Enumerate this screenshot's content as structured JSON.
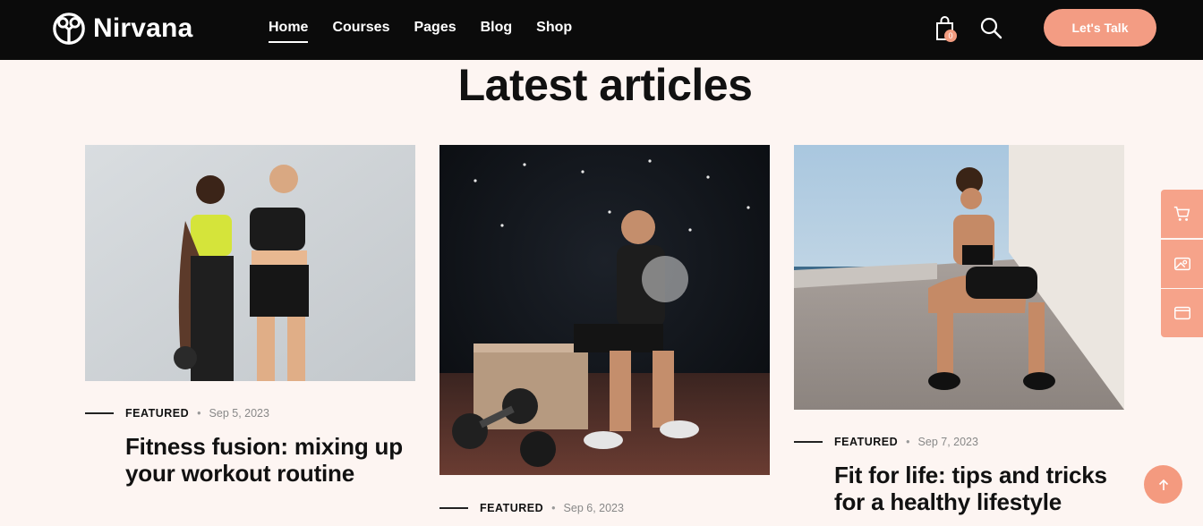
{
  "brand": {
    "name": "Nirvana"
  },
  "nav": [
    {
      "label": "Home",
      "active": true
    },
    {
      "label": "Courses"
    },
    {
      "label": "Pages"
    },
    {
      "label": "Blog"
    },
    {
      "label": "Shop"
    }
  ],
  "header": {
    "cart_count": "0",
    "cta_label": "Let's Talk"
  },
  "section": {
    "title": "Latest articles"
  },
  "articles": [
    {
      "tag": "FEATURED",
      "date": "Sep 5, 2023",
      "title_line1": "Fitness fusion: mixing up",
      "title_line2": "your workout routine"
    },
    {
      "tag": "FEATURED",
      "date": "Sep 6, 2023"
    },
    {
      "tag": "FEATURED",
      "date": "Sep 7, 2023",
      "title_line1": "Fit for life: tips and tricks",
      "title_line2": "for a healthy lifestyle"
    }
  ],
  "colors": {
    "accent": "#f39c83",
    "header_bg": "#0b0b0b",
    "page_bg": "#fdf5f2"
  },
  "icons": {
    "side_tabs": [
      "cart-icon",
      "image-icon",
      "browser-window-icon"
    ],
    "back_to_top": "arrow-up-icon"
  }
}
